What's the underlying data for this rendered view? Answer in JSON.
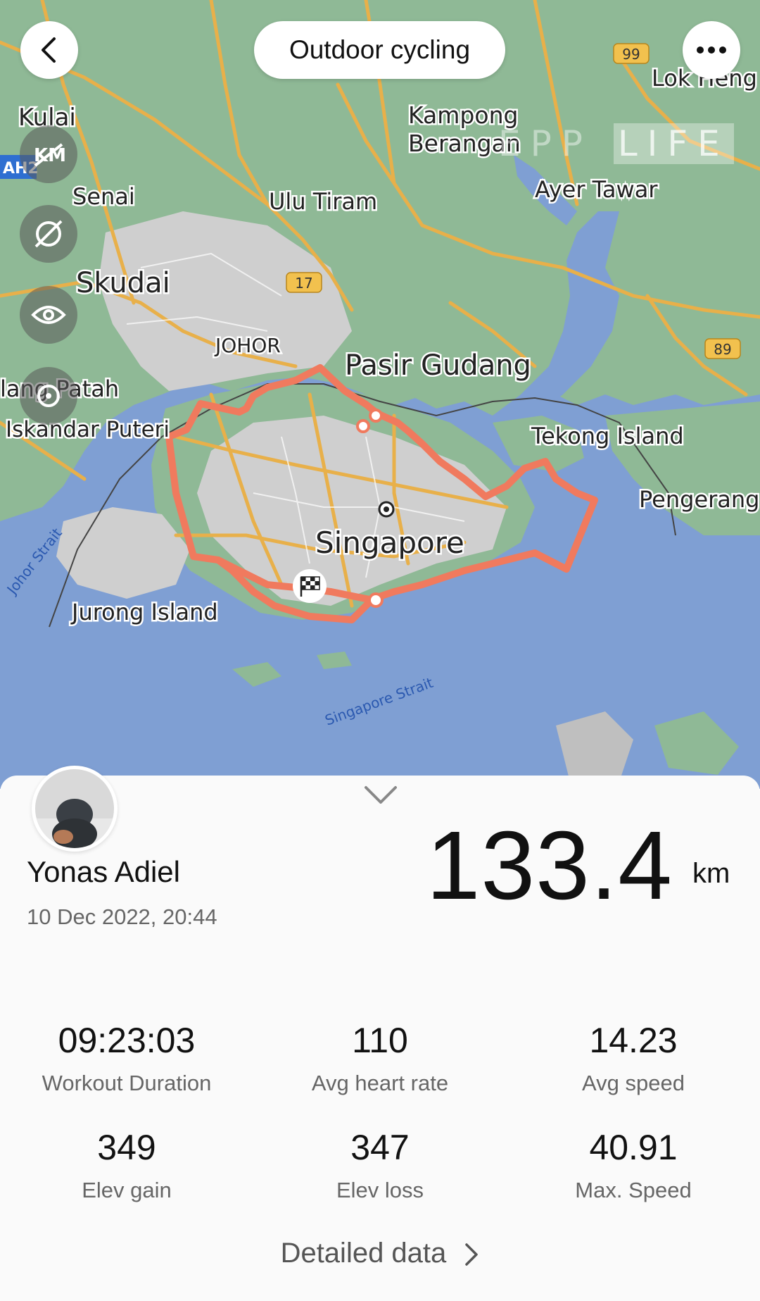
{
  "header": {
    "title": "Outdoor cycling"
  },
  "map": {
    "labels": {
      "kulai": "Kulai",
      "senai": "Senai",
      "skudai": "Skudai",
      "ulu_tiram": "Ulu Tiram",
      "kampong_1": "Kampong",
      "kampong_2": "Berangan",
      "lok_heng": "Lok Heng",
      "ayer_tawar": "Ayer Tawar",
      "johor": "JOHOR",
      "pasir_gudang": "Pasir Gudang",
      "gelang_patah": "lang Patah",
      "iskandar_puteri": "Iskandar Puteri",
      "tekong_island": "Tekong Island",
      "pengerang": "Pengerang",
      "singapore": "Singapore",
      "johor_strait": "Johor Strait",
      "jurong_island": "Jurong Island",
      "singapore_strait": "Singapore Strait",
      "ah2": "AH2"
    },
    "road_shields": [
      "99",
      "17",
      "89"
    ],
    "watermark": {
      "a": "EPP",
      "b": "LIFE"
    },
    "colors": {
      "land": "#8fb996",
      "water": "#7f9fd3",
      "urban": "#c9c9c9",
      "road": "#e8b04a",
      "route": "#f07a5e"
    }
  },
  "summary": {
    "user_name": "Yonas Adiel",
    "datetime": "10 Dec 2022, 20:44",
    "distance_value": "133.4",
    "distance_unit": "km"
  },
  "stats": [
    {
      "value": "09:23:03",
      "label": "Workout Duration"
    },
    {
      "value": "110",
      "label": "Avg heart rate"
    },
    {
      "value": "14.23",
      "label": "Avg speed"
    },
    {
      "value": "349",
      "label": "Elev gain"
    },
    {
      "value": "347",
      "label": "Elev loss"
    },
    {
      "value": "40.91",
      "label": "Max. Speed"
    }
  ],
  "footer": {
    "detailed_label": "Detailed data"
  }
}
